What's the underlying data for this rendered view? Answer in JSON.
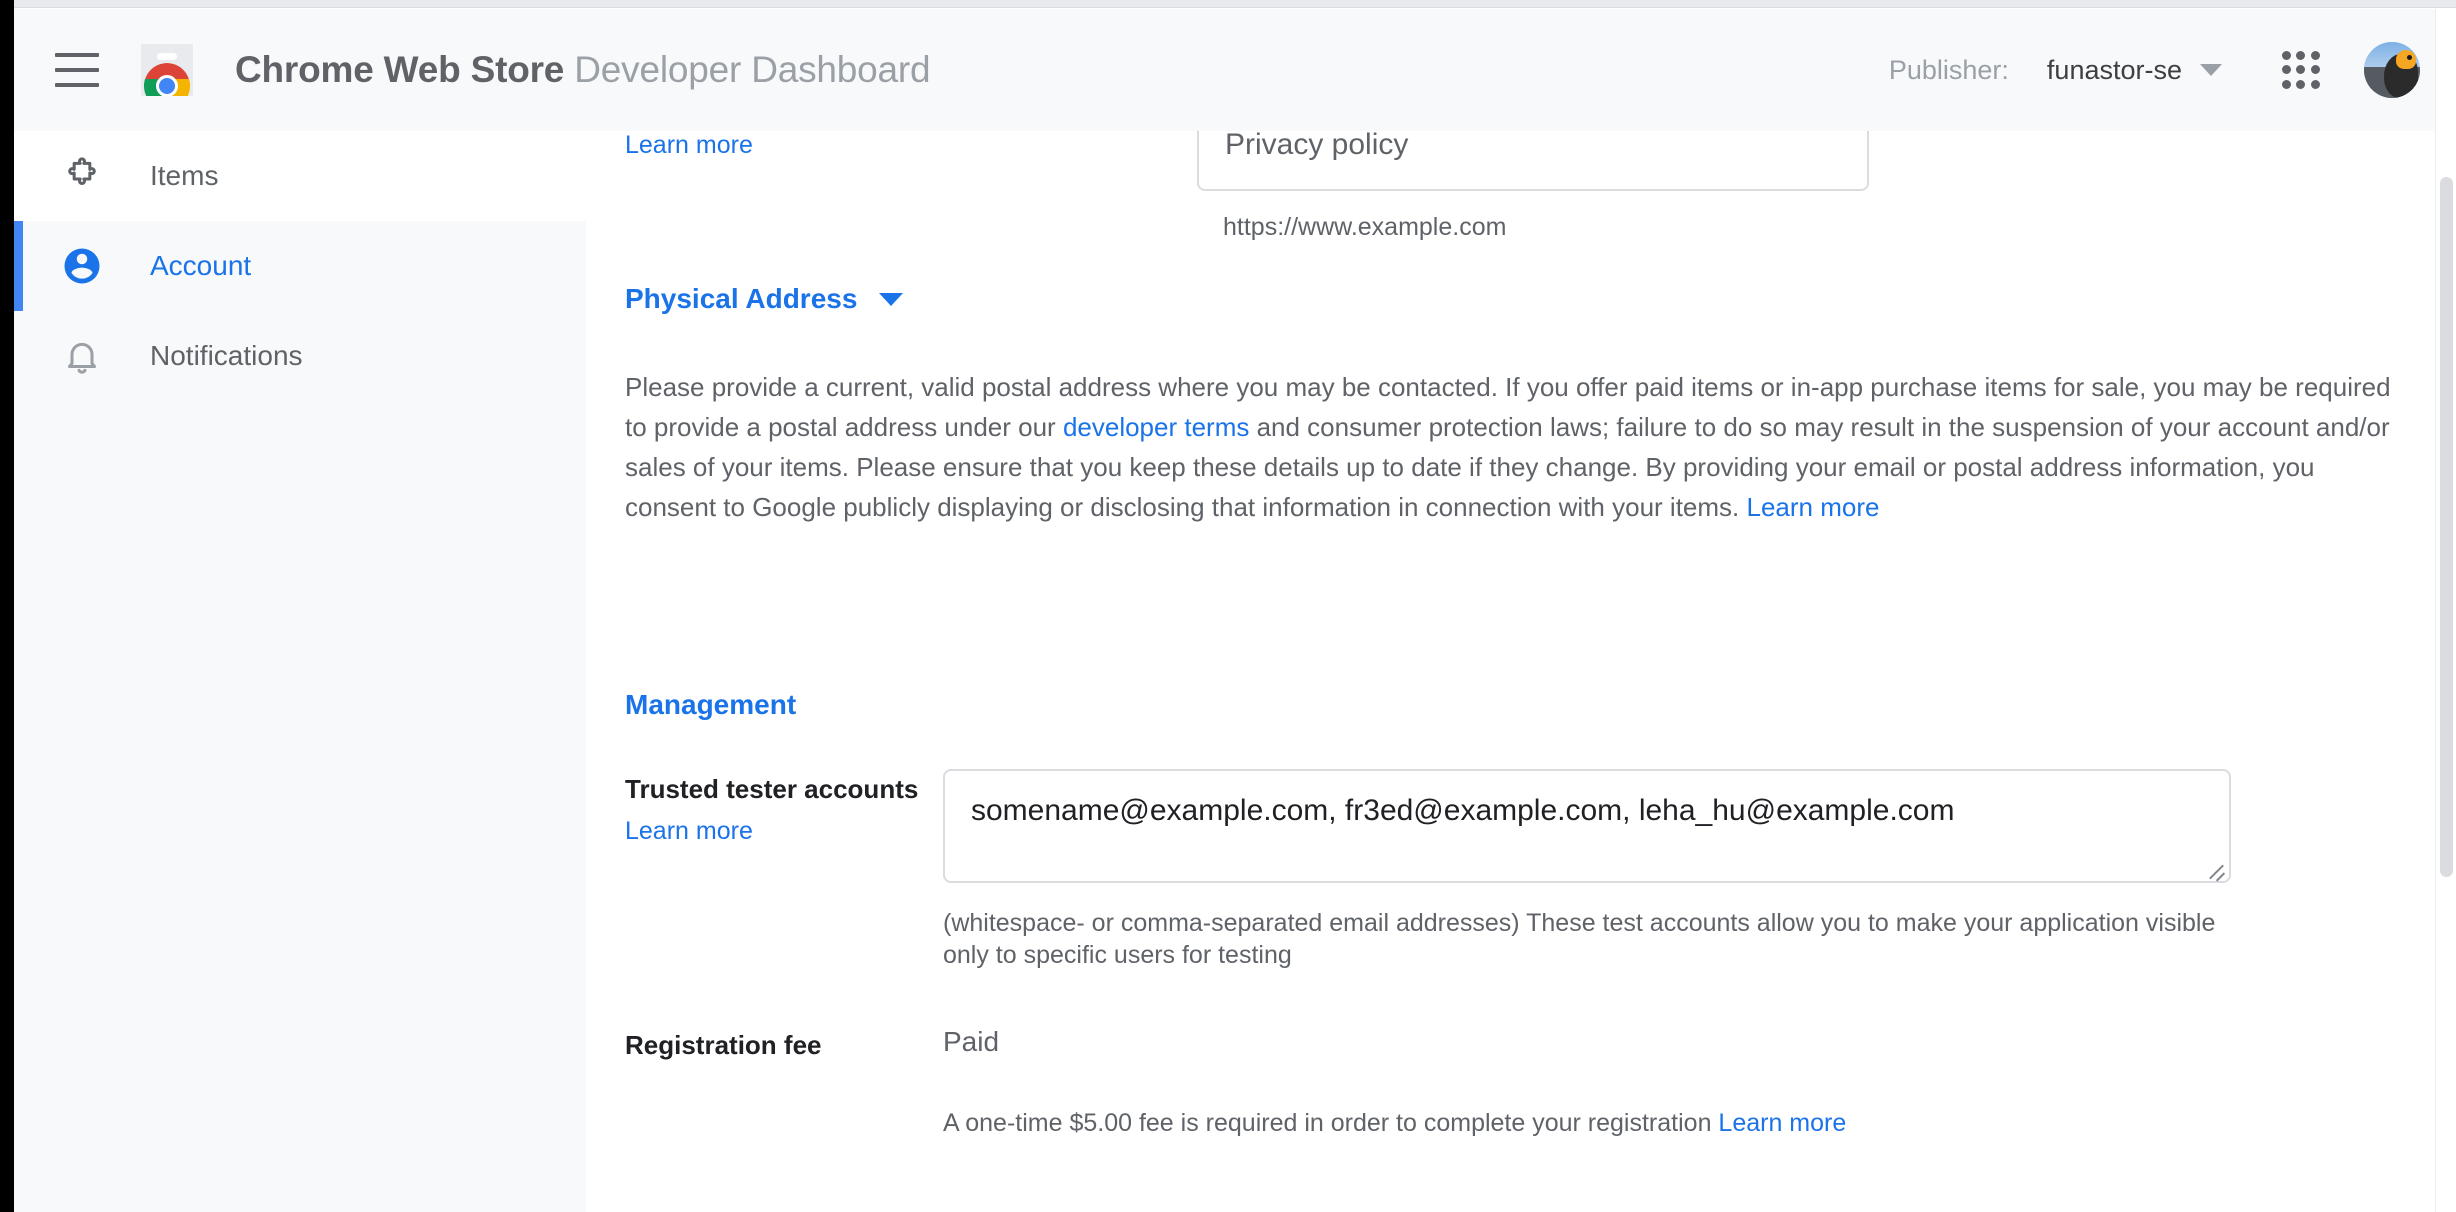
{
  "header": {
    "menu_icon": "hamburger-menu-icon",
    "logo_icon": "chrome-web-store-logo",
    "title_strong": "Chrome Web Store",
    "title_light": "Developer Dashboard",
    "publisher_label": "Publisher:",
    "publisher_value": "funastor-se",
    "publisher_caret_icon": "chevron-down-icon",
    "apps_icon": "google-apps-grid-icon",
    "avatar_icon": "user-avatar"
  },
  "sidebar": {
    "items": [
      {
        "label": "Items",
        "icon": "puzzle-piece-icon",
        "active": false
      },
      {
        "label": "Account",
        "icon": "account-circle-icon",
        "active": true
      },
      {
        "label": "Notifications",
        "icon": "bell-icon",
        "active": false
      }
    ]
  },
  "main": {
    "privacy_policy": {
      "learn_more": "Learn more",
      "value": "Privacy policy",
      "hint": "https://www.example.com"
    },
    "physical_address": {
      "heading": "Physical Address",
      "caret_icon": "chevron-down-icon",
      "paragraph_part1": "Please provide a current, valid postal address where you may be contacted. If you offer paid items or in-app purchase items for sale, you may be required to provide a postal address under our ",
      "paragraph_link": "developer terms",
      "paragraph_part2": " and consumer protection laws; failure to do so may result in the suspension of your account and/or sales of your items. Please ensure that you keep these details up to date if they change. By providing your email or postal address information, you consent to Google publicly displaying or disclosing that information in connection with your items. ",
      "paragraph_learn_more": "Learn more"
    },
    "management": {
      "heading": "Management",
      "trusted_tester": {
        "label": "Trusted tester accounts",
        "learn_more": "Learn more",
        "value": "somename@example.com, fr3ed@example.com, leha_hu@example.com",
        "helper": "(whitespace- or comma-separated email addresses) These test accounts allow you to make your application visible only to specific users for testing"
      },
      "registration_fee": {
        "label": "Registration fee",
        "value": "Paid",
        "note": "A one-time $5.00 fee is required in order to complete your registration ",
        "note_link": "Learn more"
      }
    }
  },
  "colors": {
    "accent_blue": "#1a73e8",
    "active_bar_blue": "#4285f4",
    "text_primary": "#202124",
    "text_secondary": "#5f6368",
    "sidebar_bg": "#f8f9fa",
    "border": "#dadce0"
  }
}
